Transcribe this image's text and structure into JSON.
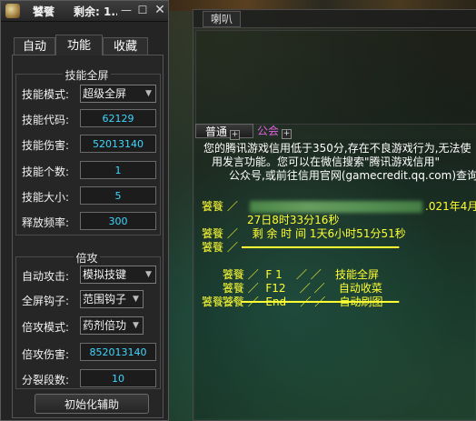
{
  "assistant": {
    "title": "饕餮",
    "remain": "剩余: 1...",
    "controls": {
      "minimize": "—",
      "maximize": "☐",
      "close": "✕"
    },
    "tabs": [
      {
        "label": "自动",
        "selected": false
      },
      {
        "label": "功能",
        "selected": true
      },
      {
        "label": "收藏",
        "selected": false
      }
    ],
    "skill_group": {
      "title": "技能全屏",
      "mode_label": "技能模式:",
      "mode_value": "超级全屏",
      "code_label": "技能代码:",
      "code_value": "62129",
      "damage_label": "技能伤害:",
      "damage_value": "52013140",
      "count_label": "技能个数:",
      "count_value": "1",
      "size_label": "技能大小:",
      "size_value": "5",
      "freq_label": "释放频率:",
      "freq_value": "300"
    },
    "multi_group": {
      "title": "倍攻",
      "auto_label": "自动攻击:",
      "auto_value": "模拟技键",
      "hook_label": "全屏钩子:",
      "hook_value": "范围钩子",
      "mode_label": "倍攻模式:",
      "mode_value": "药剂倍功",
      "damage_label": "倍攻伤害:",
      "damage_value": "852013140",
      "split_label": "分裂段数:",
      "split_value": "10"
    },
    "init_button": "初始化辅助"
  },
  "chat": {
    "top_tab": "喇叭",
    "tabs": [
      {
        "label": "普通",
        "plus": "+",
        "color": "#ffffff"
      },
      {
        "label": "公会",
        "plus": "+",
        "color": "#e060e0"
      }
    ],
    "notice": [
      "您的腾讯游戏信用低于350分,存在不良游戏行为,无法使",
      "用发言功能。您可以在微信搜索\"腾讯游戏信用\"",
      "公众号,或前往信用官网(gamecredit.qq.com)查询"
    ],
    "messages": [
      {
        "sender": "饕餮 ／",
        "text": ".021年4月"
      },
      {
        "sender": "",
        "text": "27日8时33分16秒"
      },
      {
        "sender": "饕餮 ／",
        "text": "剩 余 时 间 1天6小时51分51秒"
      },
      {
        "sender": "饕餮 ／",
        "text": "━━━━━━━━━━━━━━━━━━━━━━━━"
      },
      {
        "sender": "饕餮 ／",
        "text": "F 1    ／ ／    技能全屏"
      },
      {
        "sender": "饕餮 ／",
        "text": "F12    ／ ／    自动收菜"
      },
      {
        "sender": "饕餮 ／",
        "text": "End    ／ ／    自动刷图"
      },
      {
        "sender": "饕餮 ／",
        "text": "━━━━━━━━━━━━━━━━━━━━━━━━"
      }
    ]
  },
  "colors": {
    "value_cyan": "#3fd6ff",
    "chat_yellow": "#ffff33",
    "guild_magenta": "#e060e0"
  }
}
